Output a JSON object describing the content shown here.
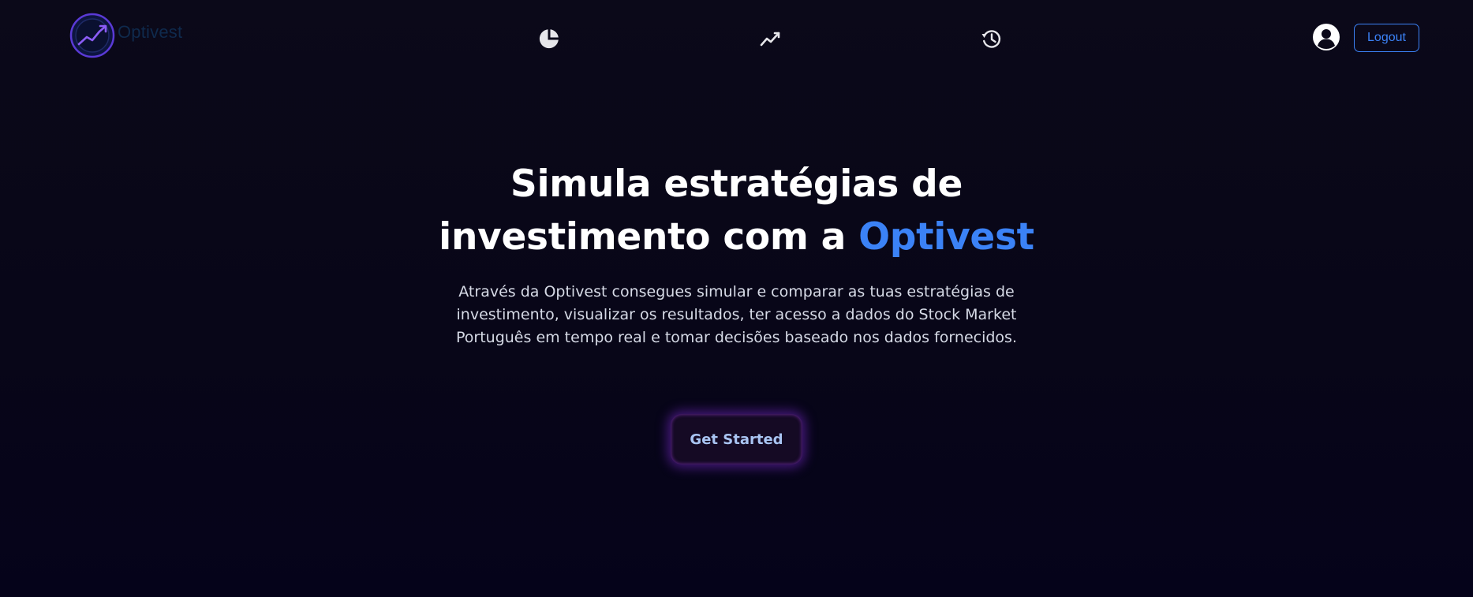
{
  "header": {
    "brand_name": "Optivest",
    "nav": [
      {
        "icon": "pie-chart-icon"
      },
      {
        "icon": "line-chart-icon"
      },
      {
        "icon": "history-icon"
      }
    ],
    "user_icon": "user-circle-icon",
    "logout_label": "Logout"
  },
  "hero": {
    "title_line1": "Simula estratégias de",
    "title_line2_prefix": "investimento com a ",
    "title_accent": "Optivest",
    "subtitle_line1": "Através da Optivest consegues simular e comparar as tuas estratégias de",
    "subtitle_line2": "investimento, visualizar os resultados, ter acesso a dados do Stock Market",
    "subtitle_line3": "Português em tempo real e tomar decisões baseado nos dados fornecidos.",
    "cta_label": "Get Started"
  },
  "colors": {
    "background": "#0b0919",
    "accent": "#3b82f6",
    "cta_text": "#a9c4f2",
    "cta_glow": "#7628c8",
    "logo_purple": "#7b3fe4"
  }
}
